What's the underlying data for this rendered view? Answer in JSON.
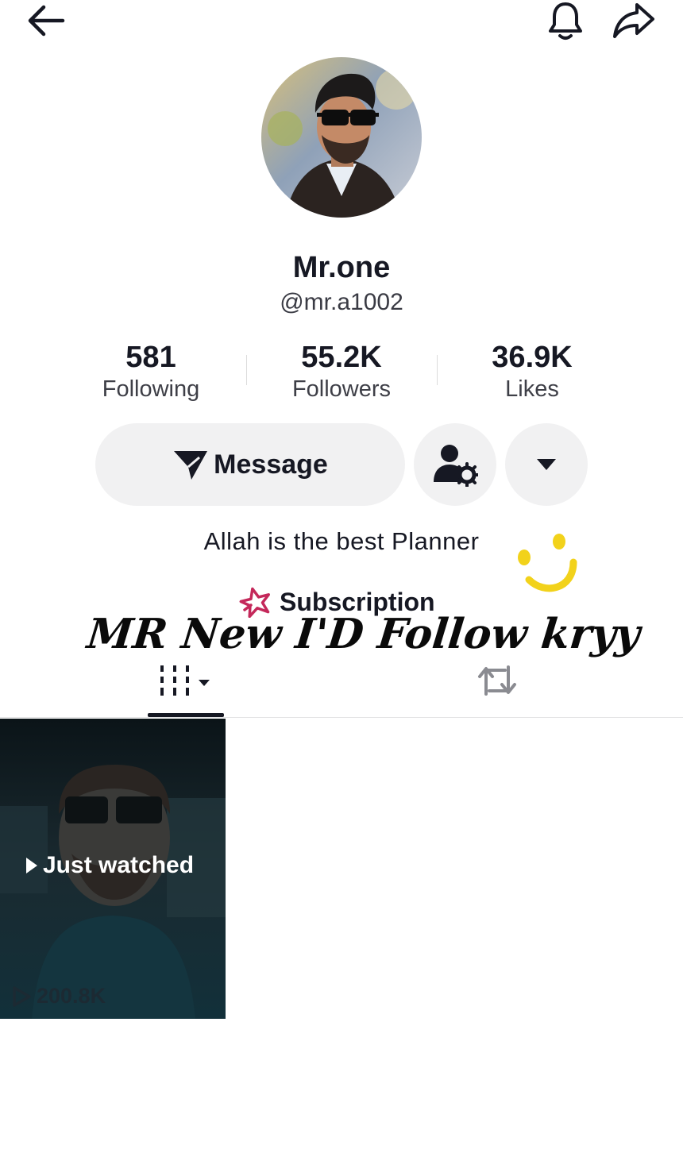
{
  "header": {
    "back_icon": "arrow-left-icon",
    "notification_icon": "bell-icon",
    "share_icon": "share-arrow-icon"
  },
  "profile": {
    "display_name": "Mr.one",
    "username": "@mr.a1002",
    "bio": "Allah is the best Planner"
  },
  "stats": [
    {
      "value": "581",
      "label": "Following"
    },
    {
      "value": "55.2K",
      "label": "Followers"
    },
    {
      "value": "36.9K",
      "label": "Likes"
    }
  ],
  "actions": {
    "message_label": "Message",
    "message_icon": "send-icon",
    "friends_icon": "user-settings-icon",
    "more_icon": "caret-down-icon"
  },
  "subscription": {
    "label": "Subscription",
    "icon": "star-icon",
    "icon_color": "#c4285a"
  },
  "overlay": {
    "text": "MR New I'D Follow kryy"
  },
  "tabs": [
    {
      "name": "videos",
      "icon": "grid-icon",
      "active": true
    },
    {
      "name": "reposts",
      "icon": "repost-icon",
      "active": false
    }
  ],
  "videos": [
    {
      "badge": "Just watched",
      "views": "200.8K"
    }
  ],
  "colors": {
    "text_primary": "#161823",
    "button_bg": "#f1f1f2",
    "smiley": "#f2d21b"
  }
}
